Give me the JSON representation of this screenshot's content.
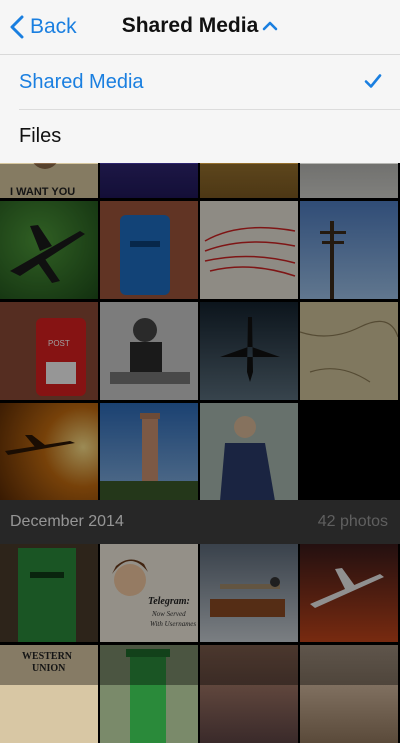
{
  "nav": {
    "back_label": "Back",
    "title": "Shared Media"
  },
  "menu": {
    "items": [
      {
        "label": "Shared Media",
        "selected": true
      },
      {
        "label": "Files",
        "selected": false
      }
    ]
  },
  "section": {
    "title": "December 2014",
    "count": "42 photos"
  },
  "photos_top": [
    "i-want-you-poster",
    "purple-sky",
    "old-postcard",
    "office-desk",
    "airplane-green-sky",
    "blue-mailbox",
    "red-flight-map",
    "power-pole",
    "red-post-box",
    "telegraph-operator",
    "airplane-night-sky",
    "old-map",
    "airplane-sunset",
    "coit-tower",
    "captain-portrait"
  ],
  "photos_bottom": [
    "green-post-box",
    "telegram-lady",
    "telegraph-key",
    "airplane-red-sky",
    "western-union-sign",
    "green-kiosk",
    "sea-sunset",
    "vintage-machine"
  ],
  "telegram_art": {
    "word": "Telegram:",
    "line1": "Now Served",
    "line2": "With Usernames"
  },
  "poster_text": "I WANT YOU",
  "post_text": "POST",
  "wu_text": {
    "line1": "WESTERN",
    "line2": "UNION"
  },
  "colors": {
    "accent": "#1a7fe0"
  }
}
